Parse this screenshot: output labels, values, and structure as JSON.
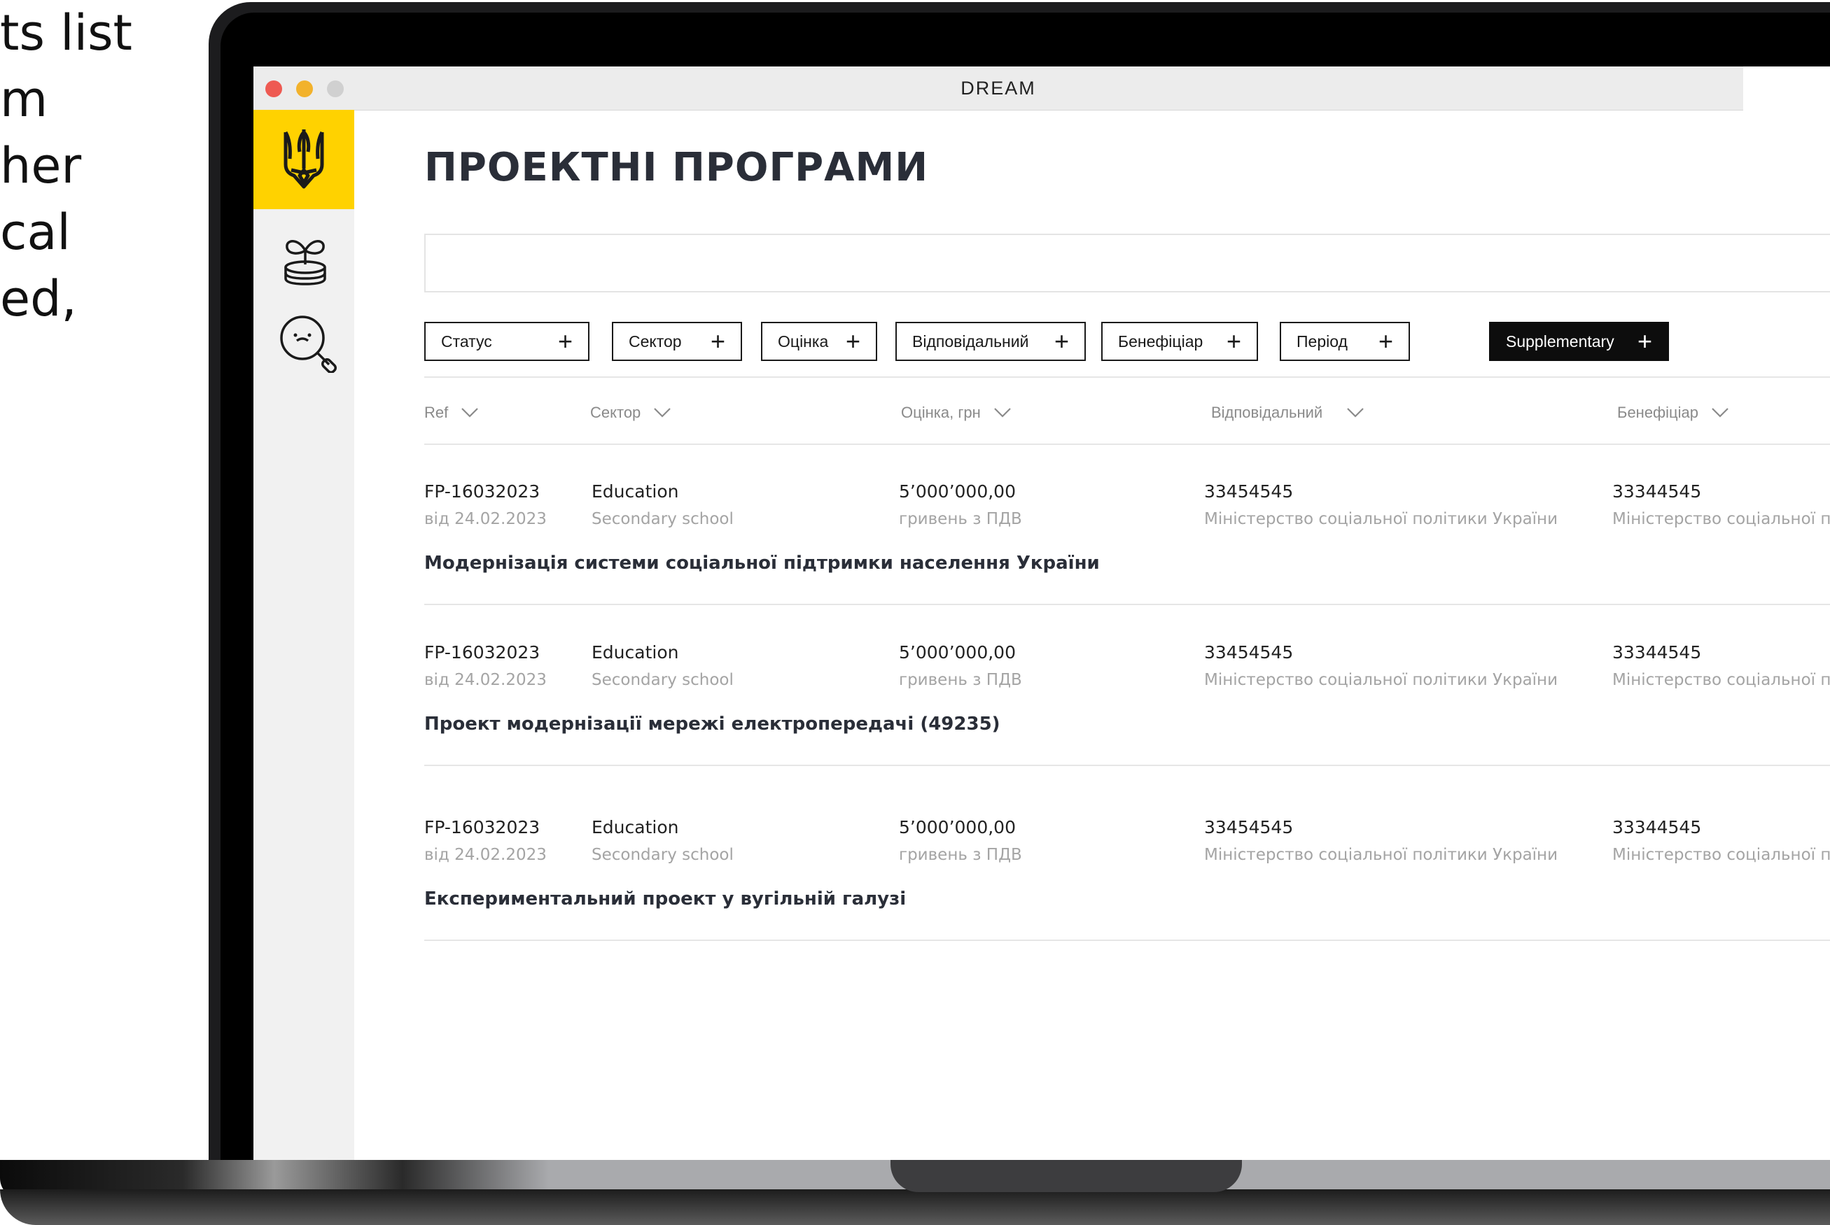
{
  "side_text": [
    "ts list",
    "m",
    "her",
    "cal",
    "ed,"
  ],
  "window": {
    "title": "DREAM",
    "traffic_lights": [
      "#ee5a52",
      "#f2b22c",
      "#d0d0d0"
    ]
  },
  "sidebar": {
    "logo_icon": "trident-icon",
    "items": [
      {
        "icon": "sprout-coins-icon"
      },
      {
        "icon": "search-face-icon"
      }
    ],
    "accent": "#ffd200"
  },
  "page": {
    "title": "ПРОЕКТНІ ПРОГРАМИ",
    "search": {
      "placeholder": "",
      "value": ""
    }
  },
  "filters": [
    {
      "label": "Статус"
    },
    {
      "label": "Сектор"
    },
    {
      "label": "Оцінка"
    },
    {
      "label": "Відповідальний"
    },
    {
      "label": "Бенефіціар"
    },
    {
      "label": "Період"
    },
    {
      "label": "Supplementary"
    }
  ],
  "columns": [
    "Ref",
    "Сектор",
    "Оцінка, грн",
    "Відповідальний",
    "Бенефіціар"
  ],
  "rows": [
    {
      "ref": "FP-16032023",
      "date": "від 24.02.2023",
      "sector": "Education",
      "sector_sub": "Secondary school",
      "amount": "5’000’000,00",
      "amount_sub": "гривень з ПДВ",
      "resp": "33454545",
      "resp_sub": "Міністерство соціальної політики України",
      "benef": "33344545",
      "benef_sub": "Міністерство соціальної по",
      "title": "Модернізація системи соціальної підтримки населення України"
    },
    {
      "ref": "FP-16032023",
      "date": "від 24.02.2023",
      "sector": "Education",
      "sector_sub": "Secondary school",
      "amount": "5’000’000,00",
      "amount_sub": "гривень з ПДВ",
      "resp": "33454545",
      "resp_sub": "Міністерство соціальної політики України",
      "benef": "33344545",
      "benef_sub": "Міністерство соціальної по",
      "title": "Проект модернізації мережі електропередачі (49235)"
    },
    {
      "ref": "FP-16032023",
      "date": "від 24.02.2023",
      "sector": "Education",
      "sector_sub": "Secondary school",
      "amount": "5’000’000,00",
      "amount_sub": "гривень з ПДВ",
      "resp": "33454545",
      "resp_sub": "Міністерство соціальної політики України",
      "benef": "33344545",
      "benef_sub": "Міністерство соціальної по",
      "title": "Експериментальний проект у вугільній галузі"
    }
  ]
}
